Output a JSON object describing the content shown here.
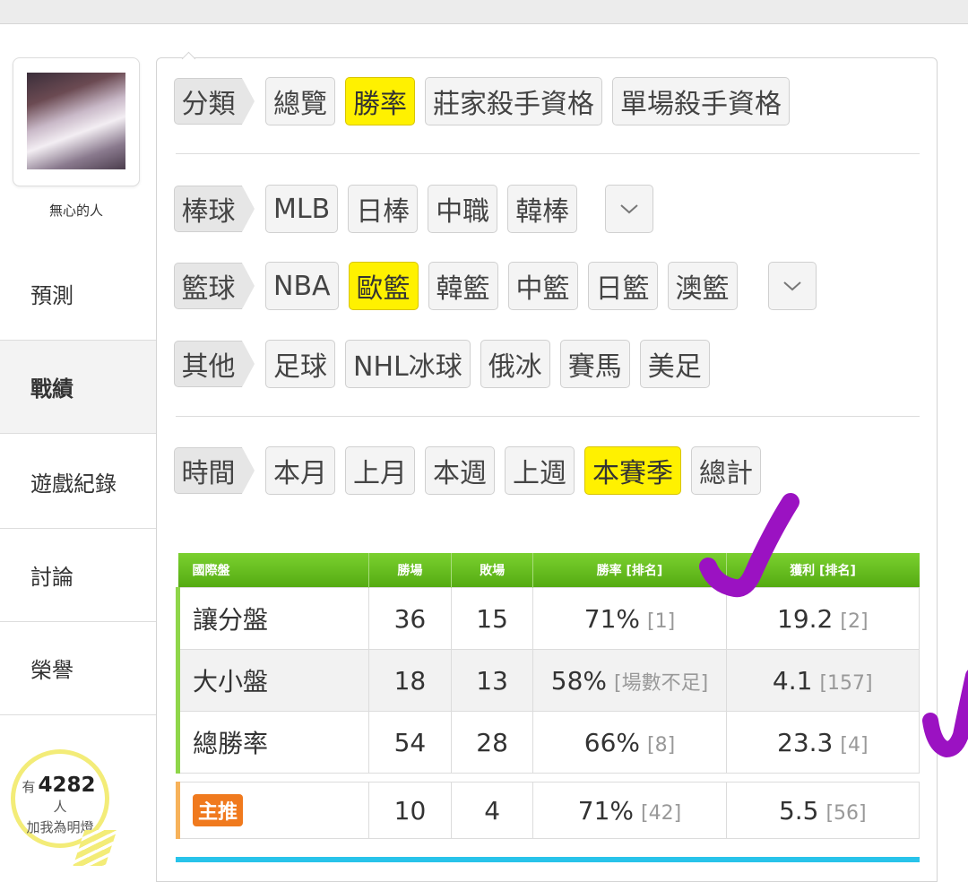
{
  "user": {
    "name": "無心的人"
  },
  "nav": [
    {
      "label": "預測",
      "active": false
    },
    {
      "label": "戰績",
      "active": true
    },
    {
      "label": "遊戲紀錄",
      "active": false
    },
    {
      "label": "討論",
      "active": false
    },
    {
      "label": "榮譽",
      "active": false
    }
  ],
  "fans": {
    "prefix": "有",
    "count": "4282",
    "suffix": "人",
    "cta": "加我為明燈"
  },
  "filters": {
    "category": {
      "label": "分類",
      "options": [
        "總覽",
        "勝率",
        "莊家殺手資格",
        "單場殺手資格"
      ],
      "selected": "勝率"
    },
    "baseball": {
      "label": "棒球",
      "options": [
        "MLB",
        "日棒",
        "中職",
        "韓棒"
      ],
      "more_icon": "chevron-down-icon"
    },
    "basketball": {
      "label": "籃球",
      "options": [
        "NBA",
        "歐籃",
        "韓籃",
        "中籃",
        "日籃",
        "澳籃"
      ],
      "selected": "歐籃",
      "more_icon": "chevron-down-icon"
    },
    "other": {
      "label": "其他",
      "options": [
        "足球",
        "NHL冰球",
        "俄冰",
        "賽馬",
        "美足"
      ]
    },
    "time": {
      "label": "時間",
      "options": [
        "本月",
        "上月",
        "本週",
        "上週",
        "本賽季",
        "總計"
      ],
      "selected": "本賽季"
    }
  },
  "table": {
    "headers": [
      "國際盤",
      "勝場",
      "敗場",
      "勝率 [排名]",
      "獲利 [排名]"
    ],
    "rows": [
      {
        "name": "讓分盤",
        "wins": "36",
        "losses": "15",
        "rate": "71%",
        "rate_rank": "[1]",
        "profit": "19.2",
        "profit_rank": "[2]"
      },
      {
        "name": "大小盤",
        "wins": "18",
        "losses": "13",
        "rate": "58%",
        "rate_rank": "[場數不足]",
        "profit": "4.1",
        "profit_rank": "[157]"
      },
      {
        "name": "總勝率",
        "wins": "54",
        "losses": "28",
        "rate": "66%",
        "rate_rank": "[8]",
        "profit": "23.3",
        "profit_rank": "[4]"
      }
    ],
    "main_pick": {
      "name": "主推",
      "wins": "10",
      "losses": "4",
      "rate": "71%",
      "rate_rank": "[42]",
      "profit": "5.5",
      "profit_rank": "[56]"
    }
  },
  "colors": {
    "selected_chip": "#fff100",
    "header_green": "#5fb81a",
    "accent_orange": "#f07a1e",
    "check_purple": "#9b12c2"
  }
}
